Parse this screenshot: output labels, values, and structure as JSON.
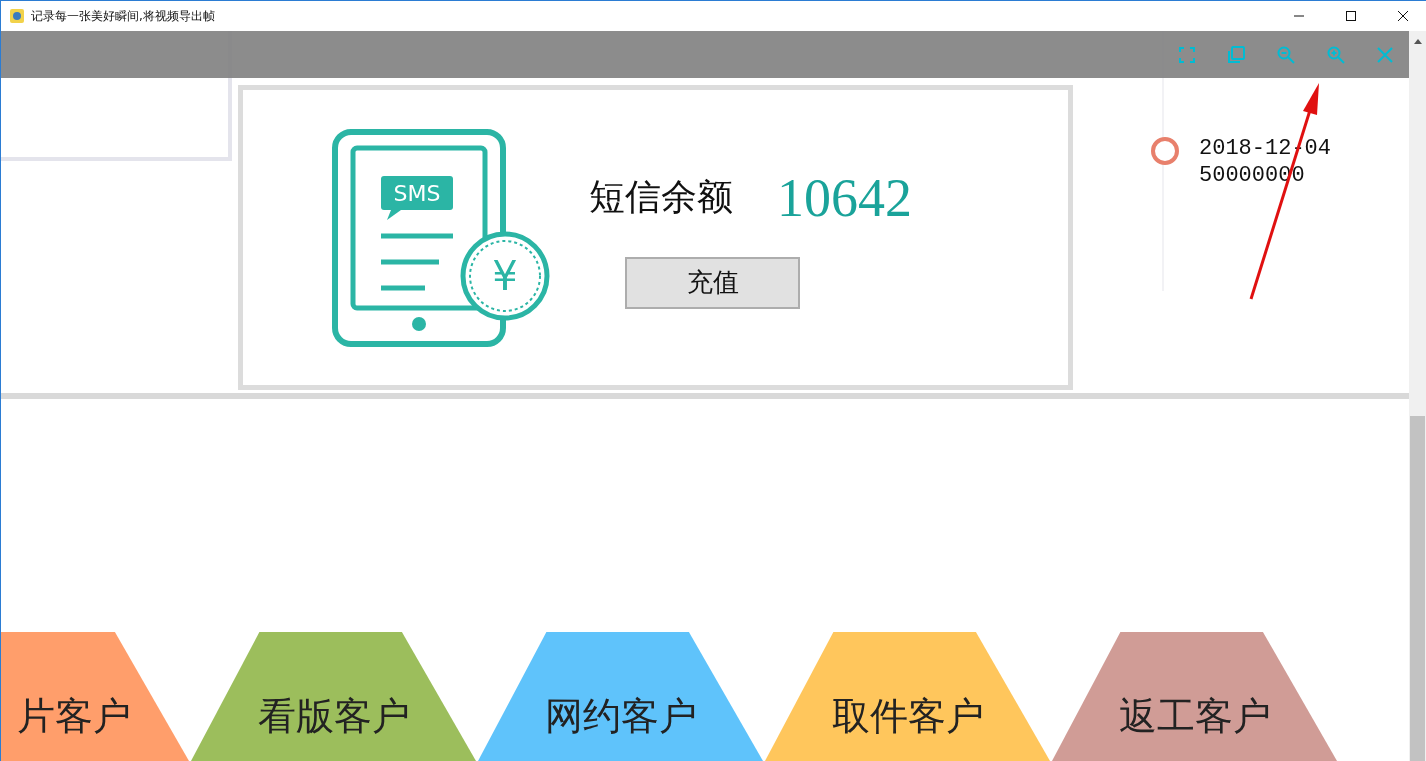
{
  "window": {
    "title": "记录每一张美好瞬间,将视频导出帧"
  },
  "viewer_toolbar": {
    "buttons": [
      {
        "kind": "fullscreen"
      },
      {
        "kind": "copy"
      },
      {
        "kind": "zoom_out"
      },
      {
        "kind": "zoom_in"
      },
      {
        "kind": "close"
      }
    ]
  },
  "sms_card": {
    "icon_badge": "SMS",
    "icon_symbol": "¥",
    "label": "短信余额",
    "balance": "10642",
    "button": "充值"
  },
  "timeline": [
    {
      "date": "2018-12-04",
      "amount": "50000000"
    }
  ],
  "customer_tabs": [
    {
      "label": "片客户",
      "color": "#ff9e6b"
    },
    {
      "label": "看版客户",
      "color": "#9cbe5c"
    },
    {
      "label": "网约客户",
      "color": "#5fc3fb"
    },
    {
      "label": "取件客户",
      "color": "#ffc65c"
    },
    {
      "label": "返工客户",
      "color": "#d09c96"
    }
  ]
}
